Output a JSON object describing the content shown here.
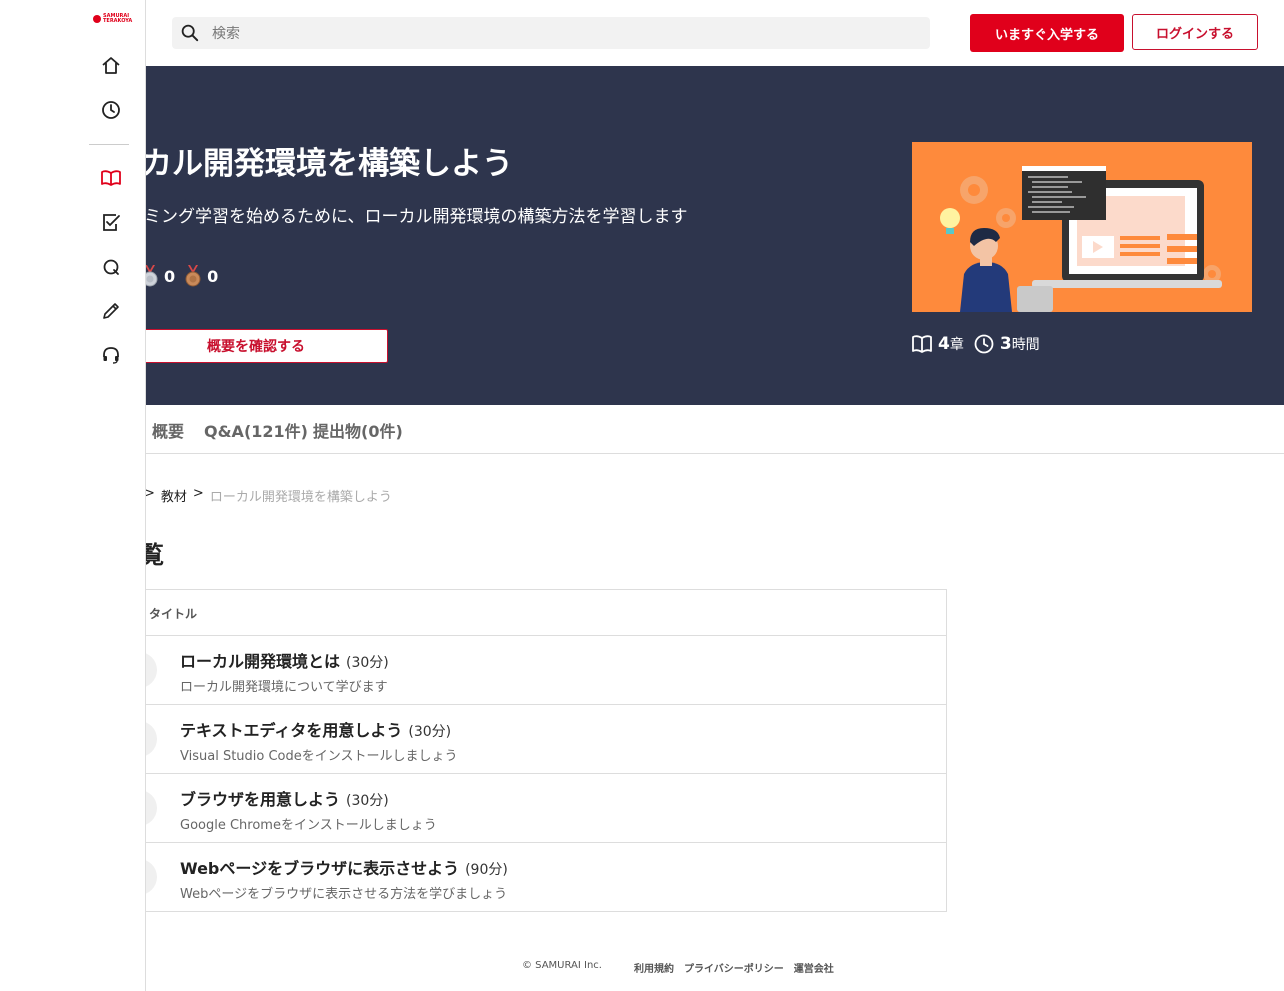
{
  "sidebar": {
    "logo_line1": "SAMURAI",
    "logo_line2": "TERAKOYA",
    "items": [
      "home-icon",
      "history-icon",
      "book-icon",
      "task-check-icon",
      "qa-icon",
      "pencil-icon",
      "headset-icon"
    ]
  },
  "header": {
    "search_placeholder": "検索",
    "enroll_label": "いますぐ入学する",
    "login_label": "ログインする"
  },
  "hero": {
    "title": "ーカル開発環境を構築しよう",
    "description": "グラミング学習を始めるために、ローカル開発環境の構築方法を学習します",
    "silver_count": "0",
    "bronze_count": "0",
    "overview_button": "概要を確認する",
    "chapters_count": "4",
    "chapters_unit": "章",
    "hours_count": "3",
    "hours_unit": "時間"
  },
  "tabs": [
    {
      "label": "概要"
    },
    {
      "label": "Q&A(121件)"
    },
    {
      "label": "提出物(0件)"
    }
  ],
  "breadcrumb": {
    "sep1": ">",
    "item1": "教材",
    "sep2": ">",
    "current": "ローカル開発環境を構築しよう"
  },
  "section_title": "覧",
  "table": {
    "header_title": "タイトル",
    "rows": [
      {
        "title": "ローカル開発環境とは",
        "duration": "(30分)",
        "desc": "ローカル開発環境について学びます"
      },
      {
        "title": "テキストエディタを用意しよう",
        "duration": "(30分)",
        "desc": "Visual Studio Codeをインストールしましょう"
      },
      {
        "title": "ブラウザを用意しよう",
        "duration": "(30分)",
        "desc": "Google Chromeをインストールしましょう"
      },
      {
        "title": "Webページをブラウザに表示させよう",
        "duration": "(90分)",
        "desc": "Webページをブラウザに表示させる方法を学びましょう"
      }
    ]
  },
  "footer": {
    "copyright": "© SAMURAI Inc.",
    "terms": "利用規約",
    "privacy": "プライバシーポリシー",
    "company": "運営会社"
  },
  "colors": {
    "brand_red": "#e0001b",
    "hero_bg": "#2e354d",
    "hero_image_bg": "#fe8a3c"
  }
}
